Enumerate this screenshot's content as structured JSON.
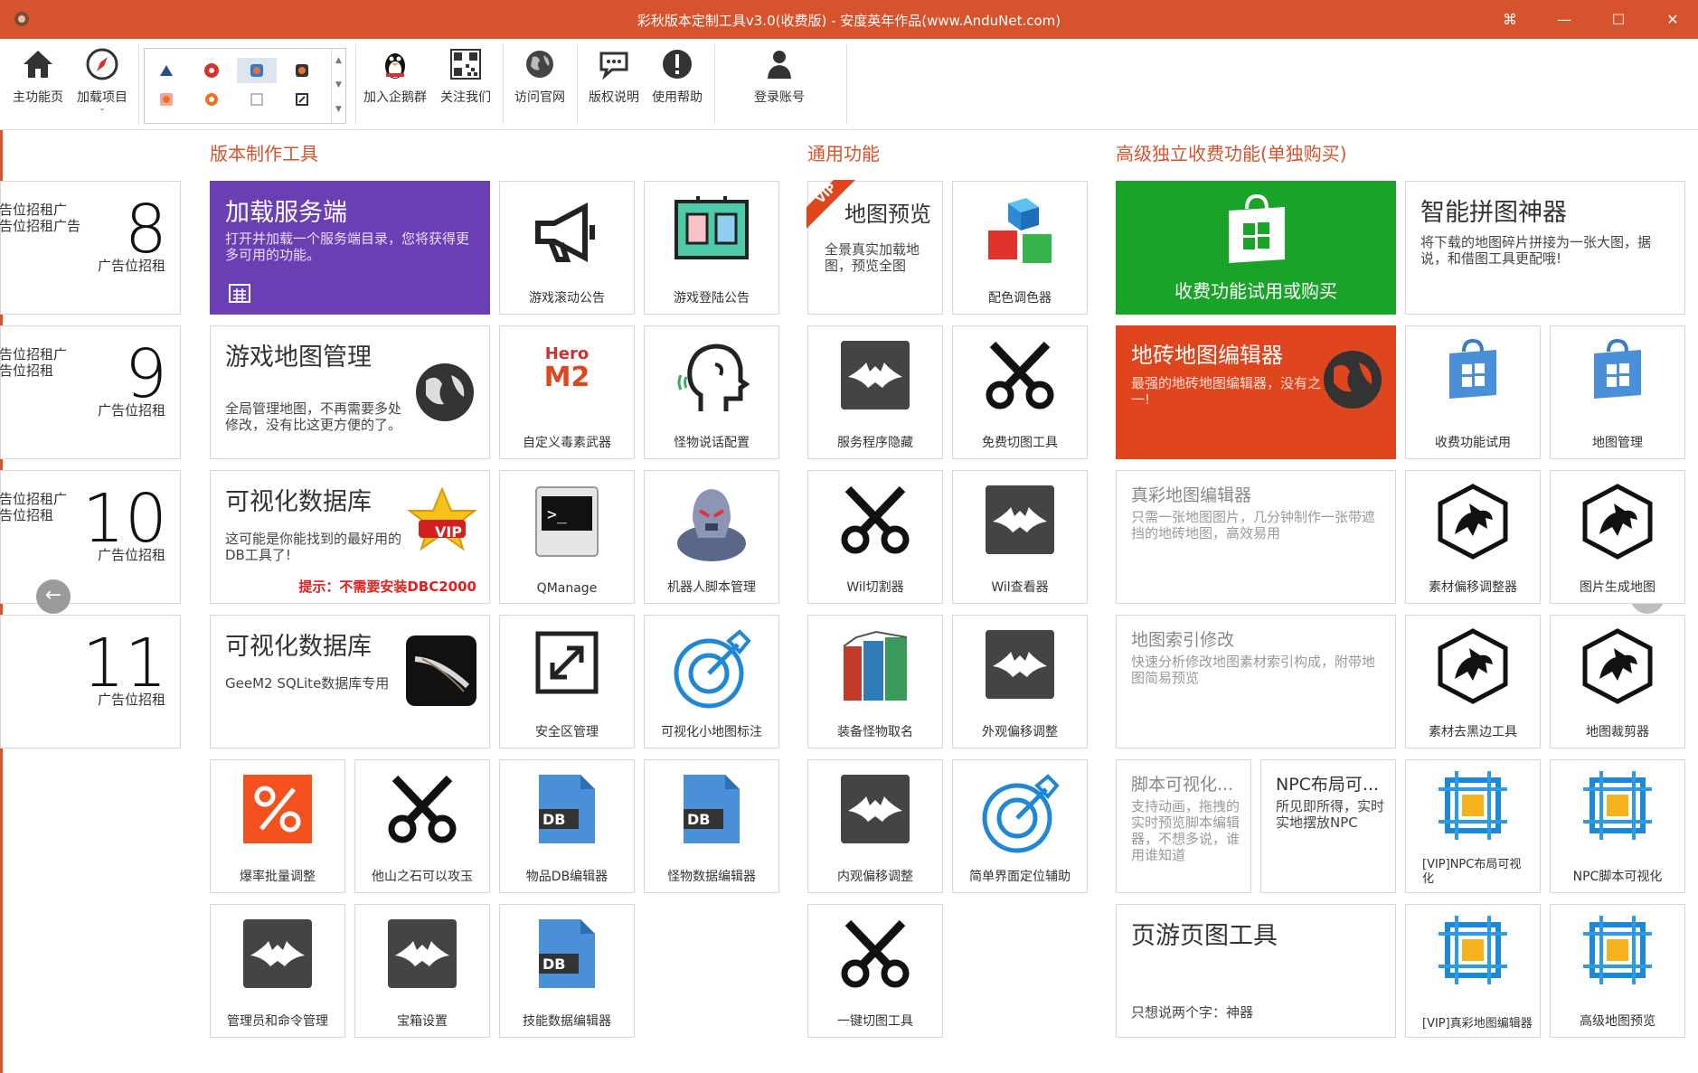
{
  "window": {
    "title": "彩秋版本定制工具v3.0(收费版) - 安度英年作品(www.AnduNet.com)",
    "controls": [
      "⌘",
      "—",
      "☐",
      "✕"
    ]
  },
  "toolbar": {
    "home": "主功能页",
    "load": "加载项目",
    "join_group": "加入企鹅群",
    "follow": "关注我们",
    "website": "访问官网",
    "copyright": "版权说明",
    "help": "使用帮助",
    "login": "登录账号"
  },
  "sections": {
    "build": "版本制作工具",
    "general": "通用功能",
    "premium": "高级独立收费功能(单独购买)"
  },
  "ads": [
    {
      "lines": [
        "告位招租广",
        "告位招租广告"
      ],
      "num": "8",
      "cap": "广告位招租"
    },
    {
      "lines": [
        "告位招租广",
        "告位招租"
      ],
      "num": "9",
      "cap": "广告位招租"
    },
    {
      "lines": [
        "告位招租广",
        "告位招租"
      ],
      "num": "10",
      "cap": "广告位招租"
    },
    {
      "lines": [],
      "num": "11",
      "cap": "广告位招租"
    }
  ],
  "wide": {
    "load_server": {
      "title": "加载服务端",
      "desc": "打开并加载一个服务端目录，您将获得更多可用的功能。"
    },
    "map_manage": {
      "title": "游戏地图管理",
      "desc": "全局管理地图，不再需要多处修改，没有比这更方便的了。"
    },
    "db1": {
      "title": "可视化数据库",
      "desc": "这可能是你能找到的最好用的DB工具了!",
      "tip": "提示：不需要安装DBC2000",
      "badge": "VIP"
    },
    "db2": {
      "title": "可视化数据库",
      "desc": "GeeM2 SQLite数据库专用"
    },
    "map_preview": {
      "title": "地图预览",
      "desc": "全景真实加载地图，预览全图",
      "badge": "VIP"
    },
    "trial": {
      "title": "收费功能试用或购买"
    },
    "puzzle": {
      "title": "智能拼图神器",
      "desc": "将下载的地图碎片拼接为一张大图，据说，和借图工具更配哦!"
    },
    "tile_editor": {
      "title": "地砖地图编辑器",
      "desc": "最强的地砖地图编辑器，没有之一!"
    },
    "true_color": {
      "title": "真彩地图编辑器",
      "desc": "只需一张地图图片，几分钟制作一张带遮挡的地砖地图，高效易用"
    },
    "index_mod": {
      "title": "地图索引修改",
      "desc": "快速分析修改地图素材索引构成，附带地图简易预览"
    },
    "script_vis": {
      "title": "脚本可视化...",
      "desc": "支持动画，拖拽的实时预览脚本编辑器，不想多说，谁用谁知道"
    },
    "npc_layout": {
      "title": "NPC布局可...",
      "desc": "所见即所得，实时实地摆放NPC"
    },
    "web_game": {
      "title": "页游页图工具",
      "desc": "只想说两个字：神器"
    }
  },
  "tiles": {
    "scroll_notice": "游戏滚动公告",
    "login_notice": "游戏登陆公告",
    "poison": "自定义毒素武器",
    "monster_talk": "怪物说话配置",
    "qmanage": "QManage",
    "robot": "机器人脚本管理",
    "safe_zone": "安全区管理",
    "minimap": "可视化小地图标注",
    "drop_rate": "爆率批量调整",
    "stone": "他山之石可以攻玉",
    "item_db": "物品DB编辑器",
    "monster_db": "怪物数据编辑器",
    "admin": "管理员和命令管理",
    "chest": "宝箱设置",
    "skill_db": "技能数据编辑器",
    "color_picker": "配色调色器",
    "service_hide": "服务程序隐藏",
    "free_cut": "免费切图工具",
    "wil_cut": "Wil切割器",
    "wil_view": "Wil查看器",
    "naming": "装备怪物取名",
    "outer_offset": "外观偏移调整",
    "inner_offset": "内观偏移调整",
    "ui_locate": "简单界面定位辅助",
    "one_cut": "一键切图工具",
    "trial_func": "收费功能试用",
    "map_mgr": "地图管理",
    "mat_offset": "素材偏移调整器",
    "img_gen": "图片生成地图",
    "mat_border": "素材去黑边工具",
    "map_crop": "地图裁剪器",
    "vip_npc": "[VIP]NPC布局可视化",
    "npc_script": "NPC脚本可视化",
    "vip_true": "[VIP]真彩地图编辑器",
    "adv_preview": "高级地图预览"
  },
  "colors": {
    "accent": "#d6532d",
    "purple": "#6b3fb4",
    "green": "#1aa329",
    "orange": "#e0461d",
    "blue": "#1e88d6"
  }
}
